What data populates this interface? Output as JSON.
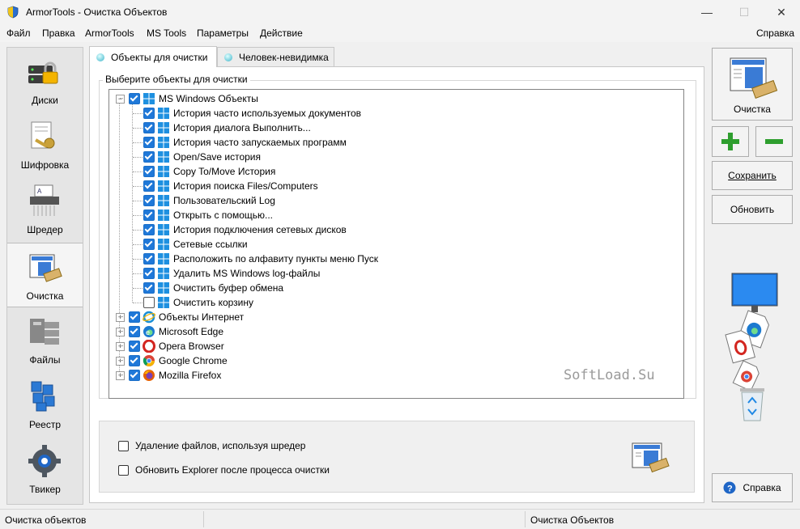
{
  "window": {
    "title": "ArmorTools - Очистка Объектов",
    "minimize": "—",
    "maximize": "☐",
    "close": "✕"
  },
  "menu": {
    "items": [
      "Файл",
      "Правка",
      "ArmorTools",
      "MS Tools",
      "Параметры",
      "Действие"
    ],
    "help": "Справка"
  },
  "sidebar": {
    "items": [
      {
        "label": "Диски",
        "icon": "disk-lock-icon"
      },
      {
        "label": "Шифровка",
        "icon": "key-document-icon"
      },
      {
        "label": "Шредер",
        "icon": "shredder-icon"
      },
      {
        "label": "Очистка",
        "icon": "cleaner-icon"
      },
      {
        "label": "Файлы",
        "icon": "files-icon"
      },
      {
        "label": "Реестр",
        "icon": "registry-icon"
      },
      {
        "label": "Твикер",
        "icon": "gear-icon"
      }
    ],
    "active_index": 3
  },
  "tabs": [
    {
      "label": "Объекты для очистки",
      "active": true
    },
    {
      "label": "Человек-невидимка",
      "active": false
    }
  ],
  "group": {
    "legend": "Выберите объекты для очистки"
  },
  "tree": {
    "root": {
      "label": "MS Windows Объекты",
      "checked": true,
      "expanded": true,
      "icon": "windows-icon"
    },
    "children": [
      {
        "label": "История часто используемых документов",
        "checked": true
      },
      {
        "label": "История диалога Выполнить...",
        "checked": true
      },
      {
        "label": "История часто запускаемых программ",
        "checked": true
      },
      {
        "label": "Open/Save история",
        "checked": true
      },
      {
        "label": "Copy To/Move История",
        "checked": true
      },
      {
        "label": "История поиска Files/Computers",
        "checked": true
      },
      {
        "label": "Пользовательский Log",
        "checked": true
      },
      {
        "label": "Открыть с помощью...",
        "checked": true
      },
      {
        "label": "История подключения сетевых дисков",
        "checked": true
      },
      {
        "label": "Сетевые ссылки",
        "checked": true
      },
      {
        "label": "Расположить по алфавиту пункты меню Пуск",
        "checked": true
      },
      {
        "label": "Удалить MS Windows log-файлы",
        "checked": true
      },
      {
        "label": "Очистить буфер обмена",
        "checked": true
      },
      {
        "label": "Очистить корзину",
        "checked": false
      }
    ],
    "others": [
      {
        "label": "Объекты Интернет",
        "checked": true,
        "icon": "ie-icon"
      },
      {
        "label": "Microsoft Edge",
        "checked": true,
        "icon": "edge-icon"
      },
      {
        "label": "Opera Browser",
        "checked": true,
        "icon": "opera-icon"
      },
      {
        "label": "Google Chrome",
        "checked": true,
        "icon": "chrome-icon"
      },
      {
        "label": "Mozilla Firefox",
        "checked": true,
        "icon": "firefox-icon"
      }
    ]
  },
  "watermark": "SoftLoad.Su",
  "options": [
    {
      "label": "Удаление файлов, используя шредер",
      "checked": false
    },
    {
      "label": "Обновить Explorer после процесса очистки",
      "checked": false
    }
  ],
  "actions": {
    "clean": "Очистка",
    "save": "Сохранить",
    "refresh": "Обновить",
    "help": "Справка"
  },
  "status": {
    "left": "Очистка объектов",
    "right": "Очистка Объектов"
  },
  "colors": {
    "accent": "#1f78d8",
    "plus": "#2e9e2e",
    "minus": "#2e9e2e"
  }
}
